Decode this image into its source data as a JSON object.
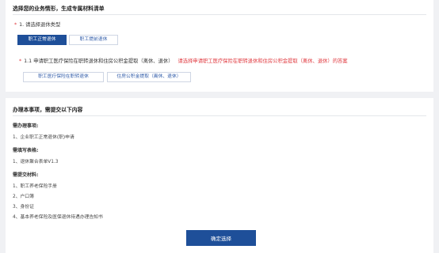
{
  "top_section": {
    "title": "选择您的业务情形，生成专属材料清单",
    "q1": {
      "label": "1. 请选择退休类型",
      "options": [
        "职工正常退休",
        "职工提前退休"
      ]
    },
    "q1_1": {
      "label": "1.1 申请职工医疗保险在职转退休和住房公积金提取（离休、退休）",
      "hint": "请选择申请职工医疗保险在职转退休和住房公积金提取（离休、退休）的答案",
      "options": [
        "职工医疗保险在职转退休",
        "住房公积金提取（离休、退休）"
      ]
    }
  },
  "bottom_section": {
    "title": "办理本事项，需提交以下内容",
    "matters": {
      "label": "需办理事项:",
      "items": [
        "1、企业职工正常退休(职)申请"
      ]
    },
    "forms": {
      "label": "需填写表格:",
      "items": [
        "1、退休聚合表单V1.3"
      ]
    },
    "materials": {
      "label": "需提交材料:",
      "items": [
        "1、职工养老保险手册",
        "2、户口簿",
        "3、身份证",
        "4、基本养老保险及医保退休待遇办理告知书"
      ]
    },
    "confirm_label": "确定选择"
  }
}
